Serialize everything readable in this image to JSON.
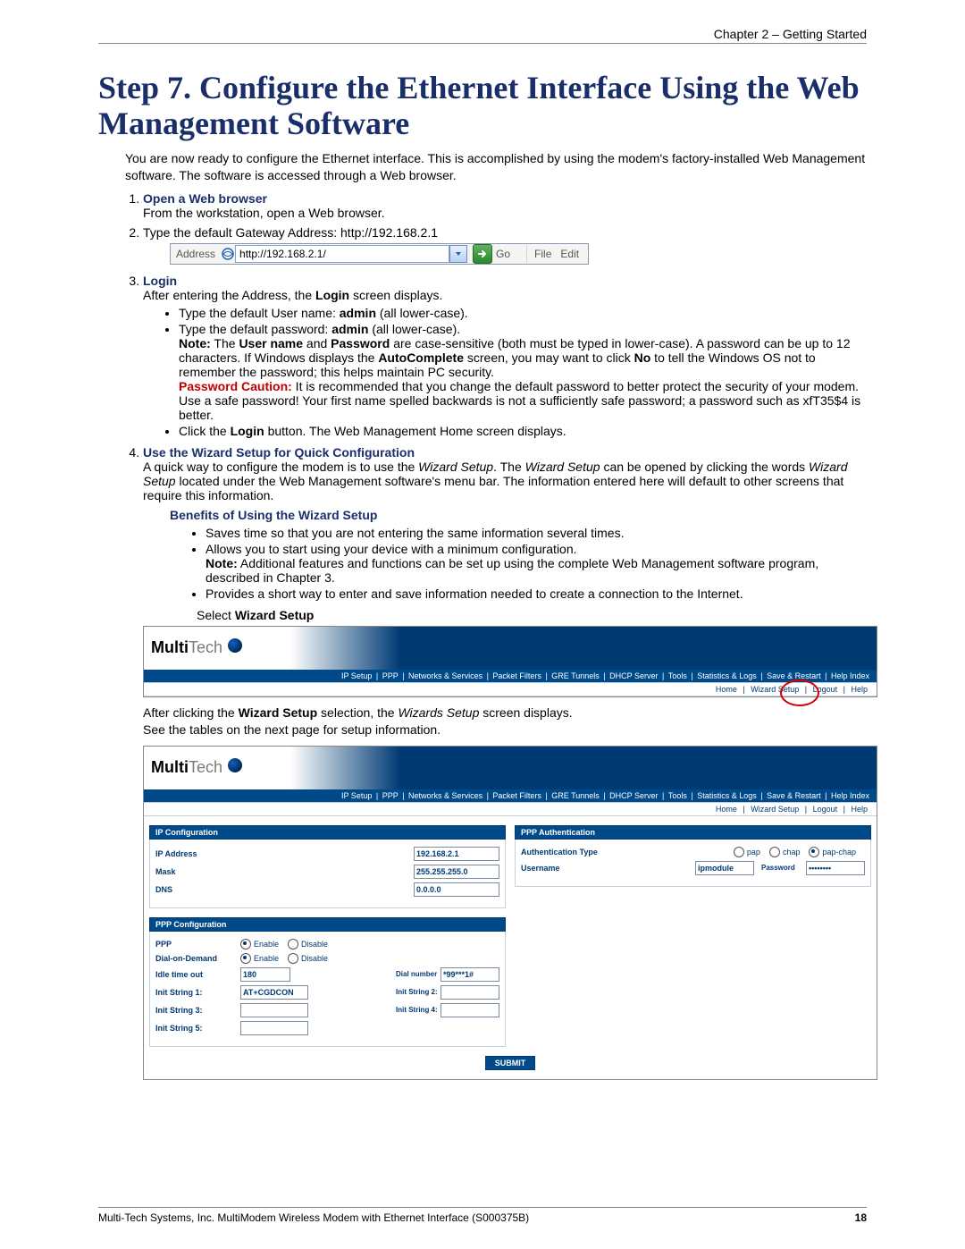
{
  "header": {
    "chapter": "Chapter 2 – Getting Started"
  },
  "title": "Step 7.  Configure the Ethernet Interface Using the Web Management Software",
  "intro": "You are now ready to configure the Ethernet interface. This is accomplished by using the modem's factory-installed Web Management software. The software is accessed through a Web browser.",
  "steps": {
    "1": {
      "heading": "Open a Web browser",
      "text": "From the workstation, open a Web browser."
    },
    "2": {
      "text_before": "Type the default Gateway Address: http://192.168.2.1",
      "address_bar": {
        "label": "Address",
        "url": "http://192.168.2.1/",
        "go": "Go",
        "file": "File",
        "edit": "Edit"
      }
    },
    "3": {
      "heading": "Login",
      "text": "After entering the Address, the ",
      "bold1": "Login",
      "text_after": " screen displays.",
      "bullets": [
        {
          "pre": "Type the default User name: ",
          "bold": "admin",
          "post": " (all lower-case)."
        },
        {
          "pre": "Type the default password: ",
          "bold": "admin",
          "post": " (all lower-case)."
        }
      ],
      "note_label": "Note:",
      "note_text_1": " The ",
      "note_bold_username": "User name",
      "note_mid": " and ",
      "note_bold_password": "Password",
      "note_text_2": " are case-sensitive (both must be typed in lower-case). A password can be up to 12 characters. If Windows displays the ",
      "note_bold_autocomplete": "AutoComplete",
      "note_text_3": " screen, you may want to click ",
      "note_bold_no": "No",
      "note_text_4": " to tell the Windows OS not to remember the password; this helps maintain PC security.",
      "pw_caution_label": "Password Caution:",
      "pw_caution_text": " It is recommended that you change the default password to better protect the security of your modem. Use a safe password! Your first name spelled backwards is not a sufficiently safe password; a password such as xfT35$4 is better.",
      "bullet_login_pre": "Click the ",
      "bullet_login_bold": "Login",
      "bullet_login_post": " button. The Web Management Home screen displays."
    },
    "4": {
      "heading": "Use the Wizard Setup for Quick Configuration",
      "text_1": "A quick way to configure the modem is to use the ",
      "italic_1": "Wizard Setup",
      "text_2": ". The ",
      "italic_2": "Wizard Setup",
      "text_3": " can be opened by clicking the words ",
      "italic_3": "Wizard Setup",
      "text_4": " located under the Web Management software's menu bar. The information entered here will default to other screens that require this information.",
      "benefits_heading": "Benefits of Using the Wizard Setup",
      "benefits": [
        "Saves time so that you are not entering the same information several times.",
        "Allows you to start using your device with a minimum configuration.",
        "Provides a short way to enter and save information needed to create a connection to the Internet."
      ],
      "benefit2_note_label": "Note:",
      "benefit2_note_text": " Additional features and functions can be set up using the complete Web Management software program, described in Chapter 3.",
      "select_label": "Select ",
      "select_bold": "Wizard Setup"
    }
  },
  "webui": {
    "menubar": [
      "IP Setup",
      "PPP",
      "Networks & Services",
      "Packet Filters",
      "GRE Tunnels",
      "DHCP Server",
      "Tools",
      "Statistics & Logs",
      "Save & Restart",
      "Help Index"
    ],
    "submenu": [
      "Home",
      "Wizard Setup",
      "Logout",
      "Help"
    ]
  },
  "after_click_1": "After clicking the ",
  "after_click_bold": "Wizard Setup",
  "after_click_2": " selection, the ",
  "after_click_italic": "Wizards Setup",
  "after_click_3": " screen displays.",
  "after_click_4": "See the tables on the next page for setup information.",
  "wizard": {
    "ip_config": {
      "header": "IP Configuration",
      "ip_address_label": "IP Address",
      "ip_address_value": "192.168.2.1",
      "mask_label": "Mask",
      "mask_value": "255.255.255.0",
      "dns_label": "DNS",
      "dns_value": "0.0.0.0"
    },
    "ppp_config": {
      "header": "PPP Configuration",
      "ppp_label": "PPP",
      "dod_label": "Dial-on-Demand",
      "enable": "Enable",
      "disable": "Disable",
      "idle_label": "Idle time out",
      "idle_value": "180",
      "dial_number_label": "Dial number",
      "dial_number_value": "*99***1#",
      "init1_label": "Init String 1:",
      "init1_value": "AT+CGDCON",
      "init2_label": "Init String 2:",
      "init3_label": "Init String 3:",
      "init4_label": "Init String 4:",
      "init5_label": "Init String 5:"
    },
    "ppp_auth": {
      "header": "PPP Authentication",
      "auth_type_label": "Authentication Type",
      "pap": "pap",
      "chap": "chap",
      "papchap": "pap-chap",
      "username_label": "Username",
      "username_value": "ipmodule",
      "password_label": "Password",
      "password_value": "••••••••"
    },
    "submit": "SUBMIT"
  },
  "footer": {
    "left": "Multi-Tech Systems, Inc. MultiModem Wireless Modem with Ethernet Interface (S000375B)",
    "right": "18"
  }
}
